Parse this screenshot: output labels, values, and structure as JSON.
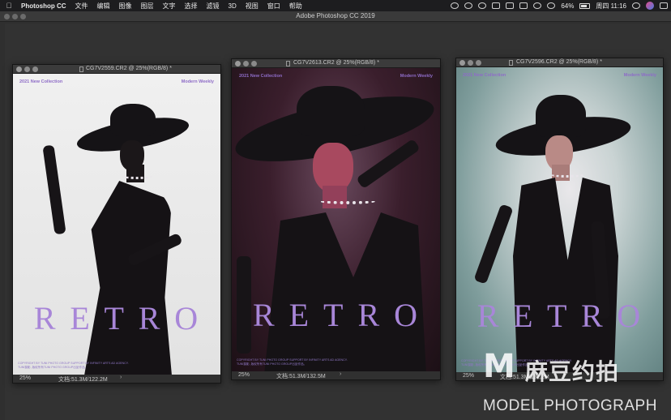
{
  "menubar": {
    "app_name": "Photoshop CC",
    "items": [
      "文件",
      "编辑",
      "图像",
      "图层",
      "文字",
      "选择",
      "滤镜",
      "3D",
      "视图",
      "窗口",
      "帮助"
    ],
    "battery": "64%",
    "clock": "周四 11:16"
  },
  "app": {
    "window_title": "Adobe Photoshop CC 2019"
  },
  "documents": [
    {
      "title": "CG7V2559.CR2 @ 25%(RGB/8) *",
      "zoom": "25%",
      "doc_size": "文档:51.3M/122.2M",
      "poster": {
        "tag_left": "2021 New Collection",
        "tag_right": "Modern Weekly",
        "letters": [
          "R",
          "E",
          "T",
          "R",
          "O"
        ],
        "copyright": "COPYRIGHT BY TUNI PHOTO GROUP SUPPORT BY INFINITY ARTS AD AGENCY.\nTUNI摄影, 版权所有TUNI PHOTO GROUP出品作品。"
      }
    },
    {
      "title": "CG7V2613.CR2 @ 25%(RGB/8) *",
      "zoom": "25%",
      "doc_size": "文档:51.3M/132.5M",
      "poster": {
        "tag_left": "2021 New Collection",
        "tag_right": "Modern Weekly",
        "letters": [
          "R",
          "E",
          "T",
          "R",
          "O"
        ],
        "copyright": "COPYRIGHT BY TUNI PHOTO GROUP SUPPORT BY INFINITY ARTS AD AGENCY.\nTUNI摄影, 版权所有TUNI PHOTO GROUP出品作品。"
      }
    },
    {
      "title": "CG7V2596.CR2 @ 25%(RGB/8) *",
      "zoom": "25%",
      "doc_size": "文档:51.3M/122.2M",
      "poster": {
        "tag_left": "2021 New Collection",
        "tag_right": "Modern Weekly",
        "letters": [
          "R",
          "E",
          "T",
          "R",
          "O"
        ],
        "copyright": "COPYRIGHT BY TUNI PHOTO GROUP SUPPORT BY INFINITY ARTS AD AGENCY.\nTUNI摄影, 版权所有TUNI PHOTO GROUP出品作品。"
      }
    }
  ],
  "watermark": {
    "logo_mark": "M",
    "cn_text": "麻豆约拍",
    "en_text": "MODEL PHOTOGRAPH"
  },
  "colors": {
    "poster1_bg": "#e6e6e6",
    "poster2_bg": "#2a1420",
    "poster3_bg": "#9fb7b5",
    "title_purple": "#a886d8"
  }
}
